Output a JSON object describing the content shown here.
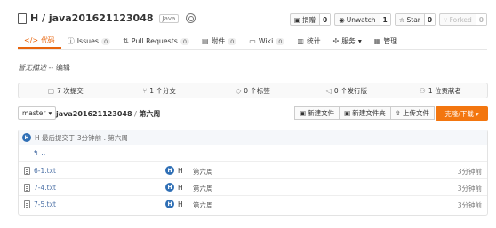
{
  "repo": {
    "title": "H / java201621123048",
    "lang": "Java"
  },
  "actions": [
    {
      "label": "捐赠",
      "count": "0",
      "icon": "donate-icon",
      "disabled": false
    },
    {
      "label": "Unwatch",
      "count": "1",
      "icon": "eye-icon",
      "disabled": false
    },
    {
      "label": "Star",
      "count": "0",
      "icon": "star-icon",
      "disabled": false
    },
    {
      "label": "Forked",
      "count": "0",
      "icon": "fork-icon",
      "disabled": true
    }
  ],
  "tabs": [
    {
      "label": "代码",
      "icon": "code-icon",
      "badge": "",
      "active": true
    },
    {
      "label": "Issues",
      "icon": "issue-icon",
      "badge": "0",
      "active": false
    },
    {
      "label": "Pull Requests",
      "icon": "pull-request-icon",
      "badge": "0",
      "active": false
    },
    {
      "label": "附件",
      "icon": "attachment-icon",
      "badge": "0",
      "active": false
    },
    {
      "label": "Wiki",
      "icon": "wiki-icon",
      "badge": "0",
      "active": false
    },
    {
      "label": "统计",
      "icon": "stats-icon",
      "badge": "",
      "active": false
    },
    {
      "label": "服务",
      "icon": "service-icon",
      "badge": "",
      "active": false
    },
    {
      "label": "管理",
      "icon": "admin-icon",
      "badge": "",
      "active": false
    }
  ],
  "description": {
    "text": "暂无描述 --",
    "edit": "编辑"
  },
  "stats": [
    {
      "label": "7 次提交",
      "icon": "commit-icon"
    },
    {
      "label": "1 个分支",
      "icon": "branch-icon"
    },
    {
      "label": "0 个标签",
      "icon": "tag-icon"
    },
    {
      "label": "0 个发行版",
      "icon": "release-icon"
    },
    {
      "label": "1 位贡献者",
      "icon": "contributor-icon"
    }
  ],
  "branch": {
    "name": "master",
    "repo_path": "java201621123048",
    "sep": " / ",
    "folder": "第六周"
  },
  "buttons": {
    "new_file": "新建文件",
    "new_folder": "新建文件夹",
    "upload": "上传文件",
    "download": "克隆/下载"
  },
  "last_commit": {
    "avatar": "H",
    "text": "H 最后提交于 3分钟前 . 第六周"
  },
  "parent_link": "..",
  "files": [
    {
      "name": "6-1.txt",
      "avatar": "H",
      "author": "H",
      "message": "第六周",
      "time": "3分钟前"
    },
    {
      "name": "7-4.txt",
      "avatar": "H",
      "author": "H",
      "message": "第六周",
      "time": "3分钟前"
    },
    {
      "name": "7-5.txt",
      "avatar": "H",
      "author": "H",
      "message": "第六周",
      "time": "3分钟前"
    }
  ]
}
